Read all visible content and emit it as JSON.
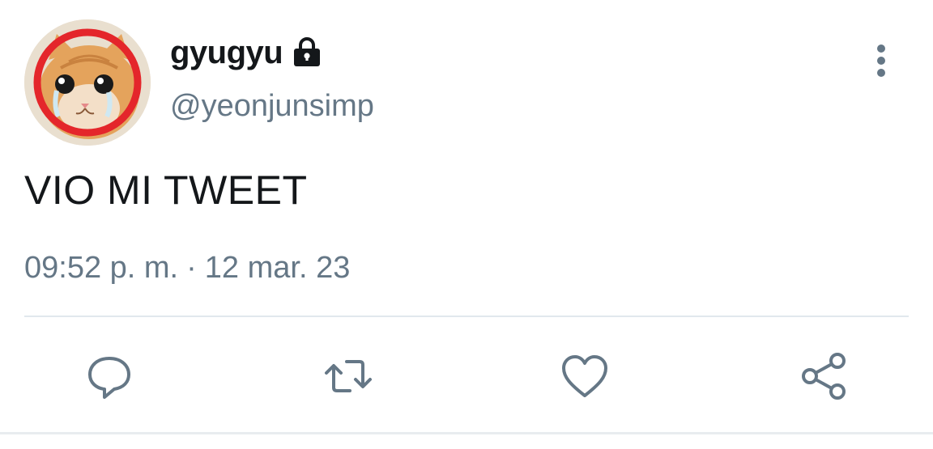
{
  "author": {
    "display_name": "gyugyu",
    "handle": "@yeonjunsimp",
    "protected_icon": "lock-icon",
    "avatar": "crying-cat-avatar"
  },
  "tweet": {
    "text": "VIO MI TWEET",
    "time": "09:52 p. m.",
    "separator": "·",
    "date": "12 mar. 23"
  },
  "menu": {
    "icon": "more-vertical-icon"
  },
  "actions": [
    {
      "icon": "reply-icon"
    },
    {
      "icon": "retweet-icon"
    },
    {
      "icon": "like-icon"
    },
    {
      "icon": "share-icon"
    }
  ],
  "colors": {
    "primary_text": "#14171a",
    "secondary_text": "#657786",
    "divider": "#e1e8ed",
    "icon": "#657786"
  }
}
